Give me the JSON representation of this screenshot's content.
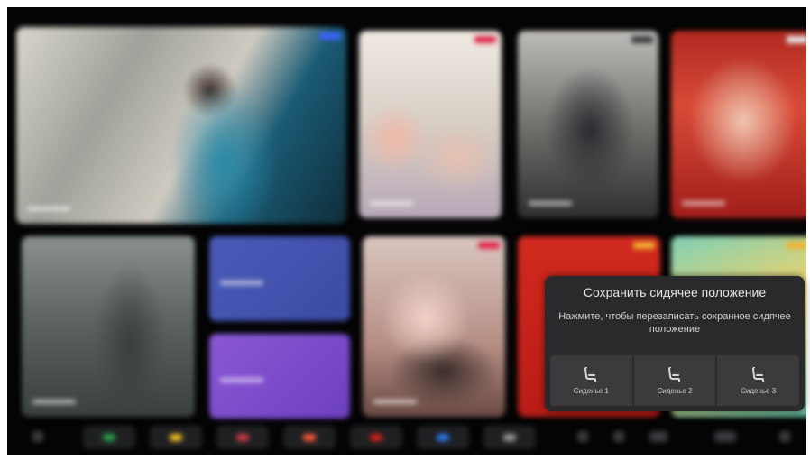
{
  "colors": {
    "screen_bg": "#040405",
    "popup_bg": "#2a2a2c",
    "seat_bg": "#3b3b3e",
    "text_primary": "#e4e4e4"
  },
  "content_tiles": [
    {
      "name": "featured-poster-1",
      "badge_color": "#3b63ff"
    },
    {
      "name": "poster-2",
      "badge_color": "#e0264a"
    },
    {
      "name": "poster-3",
      "badge_color": "#3c3c3c"
    },
    {
      "name": "poster-4",
      "badge_color": "#e6e6e6"
    },
    {
      "name": "poster-5",
      "badge_color": null
    },
    {
      "name": "category-tile-blue",
      "badge_color": null
    },
    {
      "name": "category-tile-purple",
      "badge_color": null
    },
    {
      "name": "poster-8",
      "badge_color": "#e0264a"
    },
    {
      "name": "poster-9",
      "badge_color": "#f2b233"
    },
    {
      "name": "poster-10",
      "badge_color": "#f2b233"
    }
  ],
  "dock": {
    "app_icons": [
      "home-icon",
      "phone-icon",
      "message-icon",
      "music-icon",
      "navigation-icon",
      "settings-icon",
      "bluetooth-icon",
      "apps-icon"
    ],
    "app_colors": [
      "#2aa14a",
      "#f2c21e",
      "#d23a4a",
      "#ff5a3c",
      "#d8201a",
      "#2a7ae8",
      "#9a9a9a"
    ]
  },
  "popup": {
    "title": "Сохранить сидячее положение",
    "description": "Нажмите, чтобы перезаписать сохранное сидячее положение",
    "seats": [
      {
        "label": "Сиденье 1",
        "icon": "seat-icon"
      },
      {
        "label": "Сиденье 2",
        "icon": "seat-icon"
      },
      {
        "label": "Сиденье 3",
        "icon": "seat-icon"
      }
    ]
  }
}
